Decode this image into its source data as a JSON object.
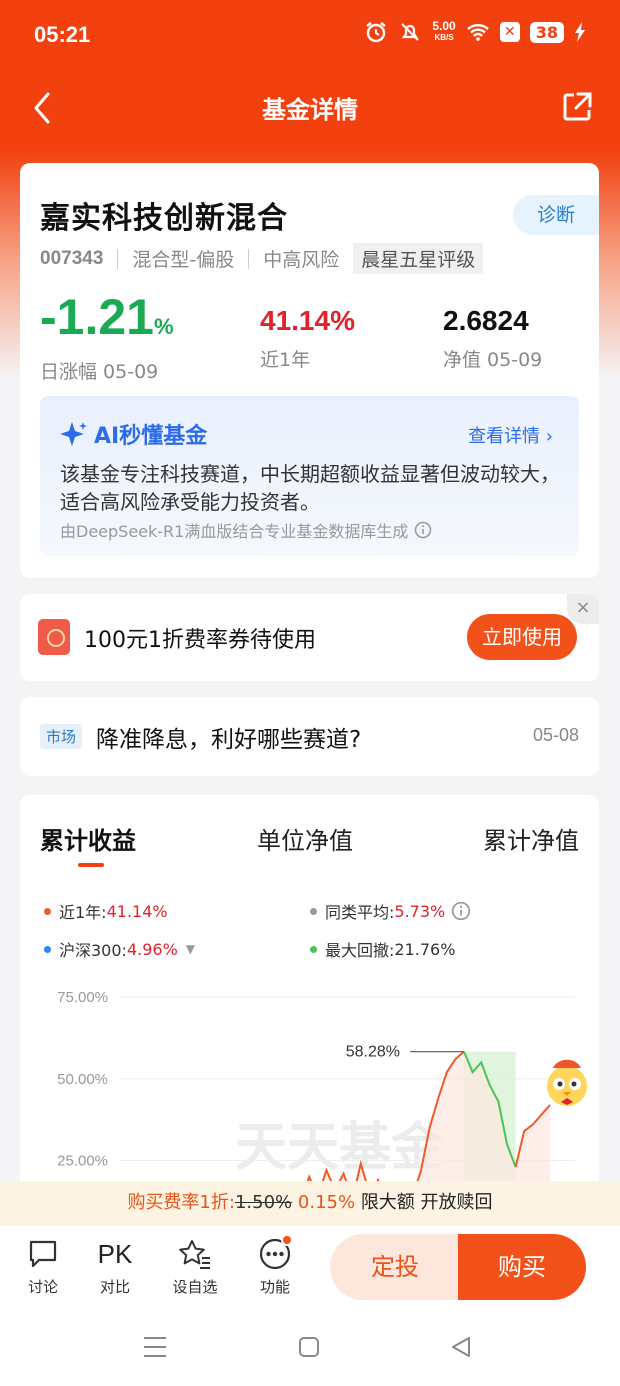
{
  "status": {
    "time": "05:21",
    "net_speed": "5.00",
    "net_unit": "KB/S",
    "battery": "38"
  },
  "nav": {
    "title": "基金详情"
  },
  "fund": {
    "name": "嘉实科技创新混合",
    "diagnose": "诊断",
    "code": "007343",
    "type": "混合型-偏股",
    "risk": "中高风险",
    "rating": "晨星五星评级",
    "daily_change": "-1.21",
    "daily_pct_sign": "%",
    "daily_label": "日涨幅 05-09",
    "year_return": "41.14%",
    "year_label": "近1年",
    "nav_value": "2.6824",
    "nav_label": "净值 05-09"
  },
  "ai": {
    "title": "AI秒懂基金",
    "more": "查看详情",
    "text": "该基金专注科技赛道，中长期超额收益显著但波动较大，适合高风险承受能力投资者。",
    "source": "由DeepSeek-R1满血版结合专业基金数据库生成"
  },
  "coupon": {
    "text": "100元1折费率券待使用",
    "button": "立即使用",
    "close": "×"
  },
  "news": {
    "tag": "市场",
    "title": "降准降息，利好哪些赛道?",
    "date": "05-08"
  },
  "chart": {
    "tabs": [
      "累计收益",
      "单位净值",
      "累计净值"
    ],
    "legend": {
      "year_label": "近1年:",
      "year_value": "41.14%",
      "peer_label": "同类平均:",
      "peer_value": "5.73%",
      "index_label": "沪深300:",
      "index_value": "4.96%",
      "drawdown_label": "最大回撤:",
      "drawdown_value": "21.76%"
    },
    "peak_label": "58.28%",
    "watermark": "天天基金",
    "colors": {
      "fund": "#f05a28",
      "peer": "#999999",
      "index": "#2f8ae6",
      "drawdown": "#4cc25a"
    }
  },
  "chart_data": {
    "type": "area",
    "yticks": [
      "75.00%",
      "50.00%",
      "25.00%"
    ],
    "ylim": [
      0,
      75
    ],
    "series": [
      {
        "name": "近1年",
        "x": [
          0,
          1,
          2,
          3,
          4,
          5,
          6,
          7,
          8,
          9,
          10,
          11,
          12,
          13,
          14,
          15,
          16,
          17,
          18,
          19,
          20,
          21,
          22,
          23,
          24,
          25,
          26,
          27,
          28,
          29,
          30,
          31,
          32,
          33,
          34,
          35,
          36,
          37,
          38,
          39,
          40,
          41,
          42,
          43,
          44,
          45,
          46,
          47,
          48,
          49,
          50
        ],
        "values": [
          0,
          0,
          0,
          0,
          0,
          0,
          0,
          0,
          0,
          0,
          0,
          0,
          0,
          0,
          0,
          0,
          0,
          0,
          0,
          0,
          18,
          12,
          20,
          14,
          22,
          16,
          21,
          13,
          24,
          15,
          19,
          12,
          17,
          15,
          14,
          22,
          35,
          44,
          52,
          56,
          58.28,
          52,
          55,
          48,
          43,
          30,
          23,
          34,
          36,
          39,
          42
        ]
      }
    ],
    "drawdown": {
      "from_index": 40,
      "to_index": 46,
      "value": "21.76%"
    }
  },
  "fee": {
    "prefix": "购买费率1折:",
    "original": "1.50%",
    "discount": "0.15%",
    "suffix": "限大额 开放赎回"
  },
  "bottom": {
    "discuss": "讨论",
    "pk_icon": "PK",
    "compare": "对比",
    "watchlist": "设自选",
    "functions": "功能",
    "plan": "定投",
    "buy": "购买"
  }
}
